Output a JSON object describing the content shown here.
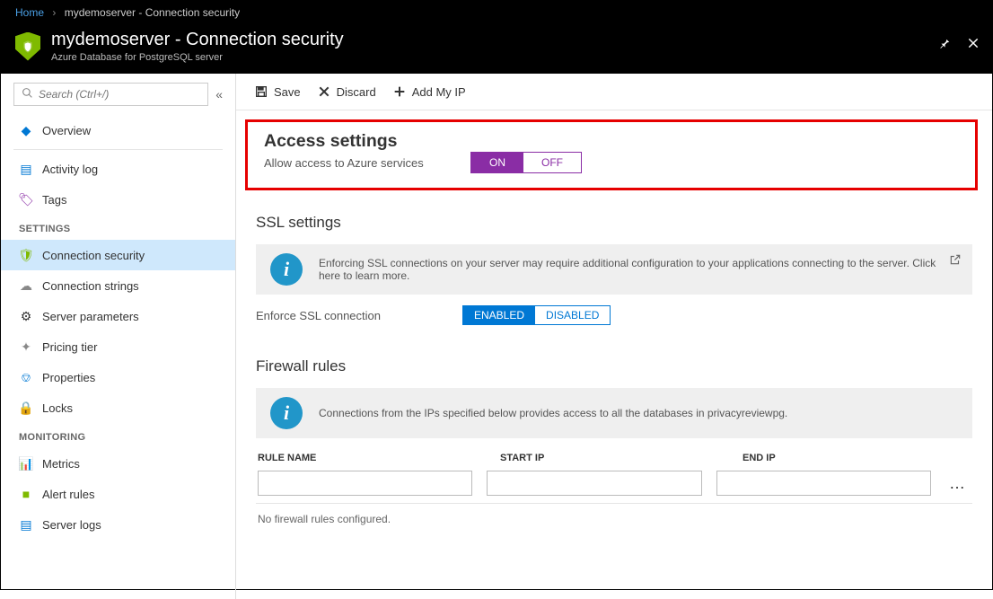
{
  "breadcrumb": {
    "home": "Home",
    "current": "mydemoserver - Connection security"
  },
  "header": {
    "title": "mydemoserver - Connection security",
    "subtitle": "Azure Database for PostgreSQL server"
  },
  "search": {
    "placeholder": "Search (Ctrl+/)"
  },
  "nav": {
    "top": [
      {
        "label": "Overview"
      },
      {
        "label": "Activity log"
      },
      {
        "label": "Tags"
      }
    ],
    "settings_label": "SETTINGS",
    "settings": [
      {
        "label": "Connection security"
      },
      {
        "label": "Connection strings"
      },
      {
        "label": "Server parameters"
      },
      {
        "label": "Pricing tier"
      },
      {
        "label": "Properties"
      },
      {
        "label": "Locks"
      }
    ],
    "monitoring_label": "MONITORING",
    "monitoring": [
      {
        "label": "Metrics"
      },
      {
        "label": "Alert rules"
      },
      {
        "label": "Server logs"
      }
    ]
  },
  "toolbar": {
    "save": "Save",
    "discard": "Discard",
    "addip": "Add My IP"
  },
  "access": {
    "title": "Access settings",
    "label": "Allow access to Azure services",
    "on": "ON",
    "off": "OFF"
  },
  "ssl": {
    "title": "SSL settings",
    "info": "Enforcing SSL connections on your server may require additional configuration to your applications connecting to the server.  Click here to learn more.",
    "enforce_label": "Enforce SSL connection",
    "enabled": "ENABLED",
    "disabled": "DISABLED"
  },
  "firewall": {
    "title": "Firewall rules",
    "info": "Connections from the IPs specified below provides access to all the databases in privacyreviewpg.",
    "col_rule": "RULE NAME",
    "col_start": "START IP",
    "col_end": "END IP",
    "empty": "No firewall rules configured."
  }
}
